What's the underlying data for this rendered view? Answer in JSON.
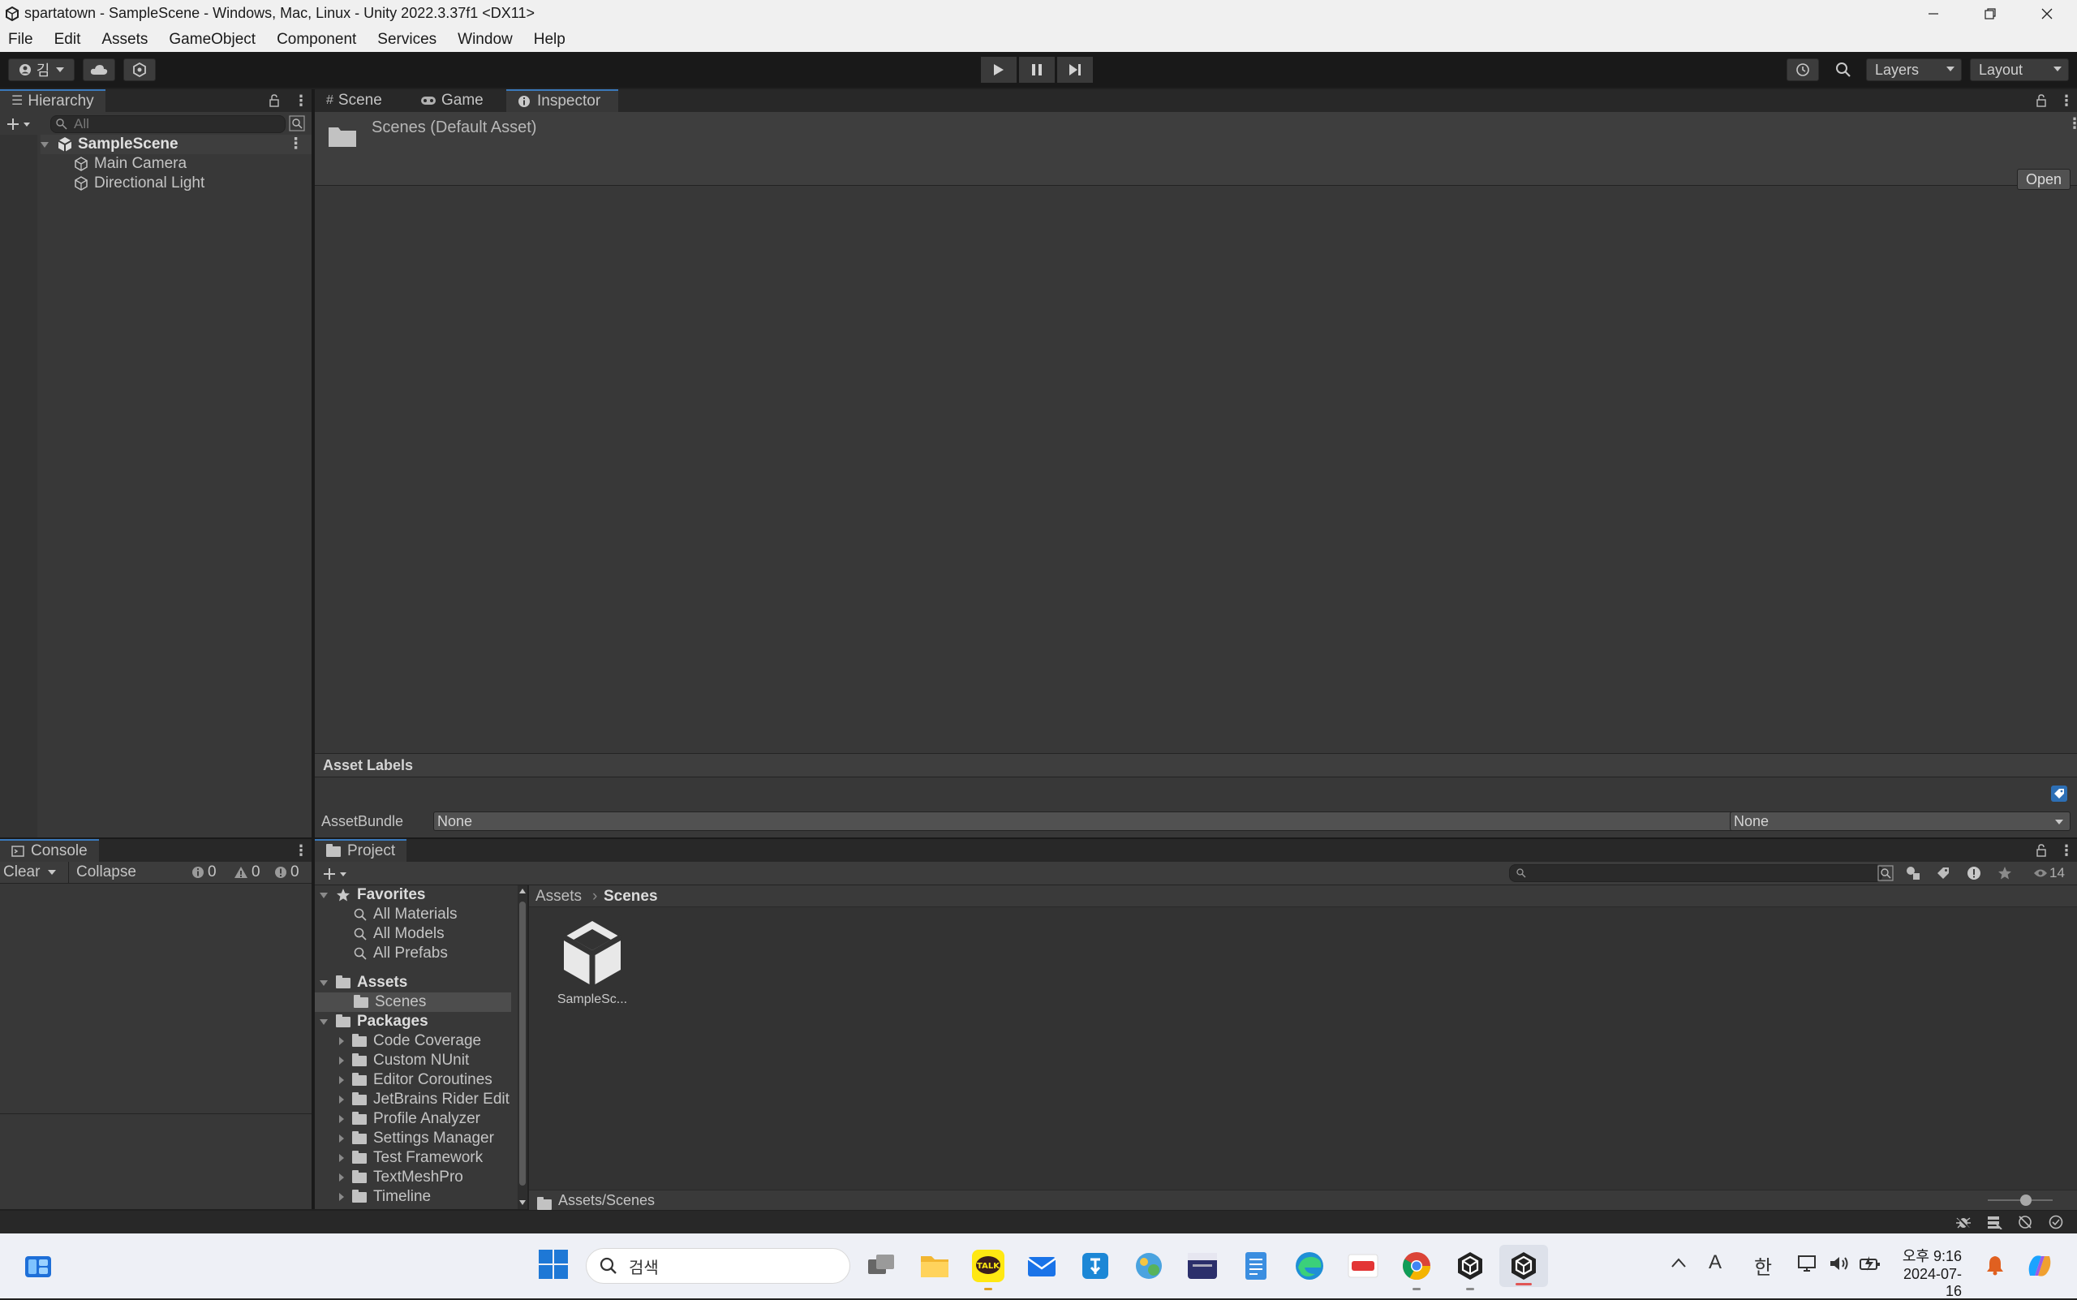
{
  "window": {
    "title": "spartatown - SampleScene - Windows, Mac, Linux - Unity 2022.3.37f1 <DX11>"
  },
  "menu": [
    "File",
    "Edit",
    "Assets",
    "GameObject",
    "Component",
    "Services",
    "Window",
    "Help"
  ],
  "toolbar": {
    "account_label": "김",
    "layers_label": "Layers",
    "layout_label": "Layout"
  },
  "hierarchy": {
    "tab_label": "Hierarchy",
    "search_placeholder": "All",
    "scene_name": "SampleScene",
    "objects": [
      "Main Camera",
      "Directional Light"
    ]
  },
  "center_tabs": [
    "Scene",
    "Game",
    "Inspector"
  ],
  "inspector": {
    "asset_title": "Scenes (Default Asset)",
    "open_button": "Open",
    "asset_labels_heading": "Asset Labels",
    "assetbundle_label": "AssetBundle",
    "assetbundle_value": "None",
    "variant_value": "None"
  },
  "console": {
    "tab_label": "Console",
    "clear_label": "Clear",
    "collapse_label": "Collapse",
    "log_count": "0",
    "warn_count": "0",
    "error_count": "0"
  },
  "project": {
    "tab_label": "Project",
    "hidden_count": "14",
    "favorites_label": "Favorites",
    "favorites": [
      "All Materials",
      "All Models",
      "All Prefabs"
    ],
    "assets_label": "Assets",
    "assets_children": [
      "Scenes"
    ],
    "packages_label": "Packages",
    "packages": [
      "Code Coverage",
      "Custom NUnit",
      "Editor Coroutines",
      "JetBrains Rider Edit",
      "Profile Analyzer",
      "Settings Manager",
      "Test Framework",
      "TextMeshPro",
      "Timeline"
    ],
    "breadcrumb": [
      "Assets",
      "Scenes"
    ],
    "grid_items": [
      "SampleSc..."
    ],
    "footer_path": "Assets/Scenes"
  },
  "taskbar": {
    "search_placeholder": "검색",
    "ime_letter": "A",
    "ime_lang": "한",
    "time": "오후 9:16",
    "date": "2024-07-16",
    "app_icons": [
      "task-view",
      "file-explorer",
      "kakaotalk",
      "mail",
      "store",
      "unity-hub-alt",
      "calendar-app",
      "notepad",
      "edge",
      "spotify-like",
      "chrome",
      "unity-hub",
      "unity-editor"
    ]
  },
  "colors": {
    "accent_tab": "#3a79bb",
    "panel_bg": "#383838",
    "toolbar_bg": "#191919"
  }
}
